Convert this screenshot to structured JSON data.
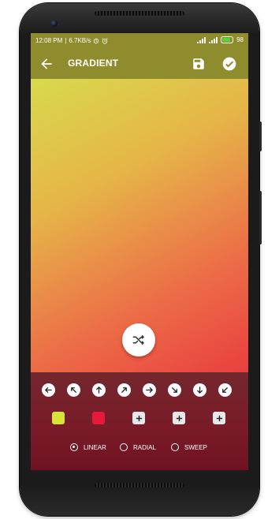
{
  "status_bar": {
    "time": "12:08 PM",
    "network_speed": "6.7KB/s",
    "battery_percent": "98"
  },
  "app_bar": {
    "title": "GRADIENT",
    "back_icon": "arrow-left-icon",
    "save_icon": "save-icon",
    "done_icon": "check-circle-icon"
  },
  "preview": {
    "colors": [
      "#d8da4c",
      "#ea3f3f"
    ],
    "shuffle_icon": "shuffle-icon"
  },
  "directions": [
    {
      "name": "left",
      "icon": "arrow-left-icon"
    },
    {
      "name": "up-left",
      "icon": "arrow-up-left-icon"
    },
    {
      "name": "up",
      "icon": "arrow-up-icon"
    },
    {
      "name": "up-right",
      "icon": "arrow-up-right-icon"
    },
    {
      "name": "right",
      "icon": "arrow-right-icon"
    },
    {
      "name": "down-right",
      "icon": "arrow-down-right-icon"
    },
    {
      "name": "down",
      "icon": "arrow-down-icon"
    },
    {
      "name": "down-left",
      "icon": "arrow-down-left-icon"
    }
  ],
  "swatches": [
    {
      "color": "#d7e33a"
    },
    {
      "color": "#e81a3c"
    }
  ],
  "add_slots": 3,
  "gradient_types": {
    "options": [
      "LINEAR",
      "RADIAL",
      "SWEEP"
    ],
    "selected": "LINEAR"
  }
}
